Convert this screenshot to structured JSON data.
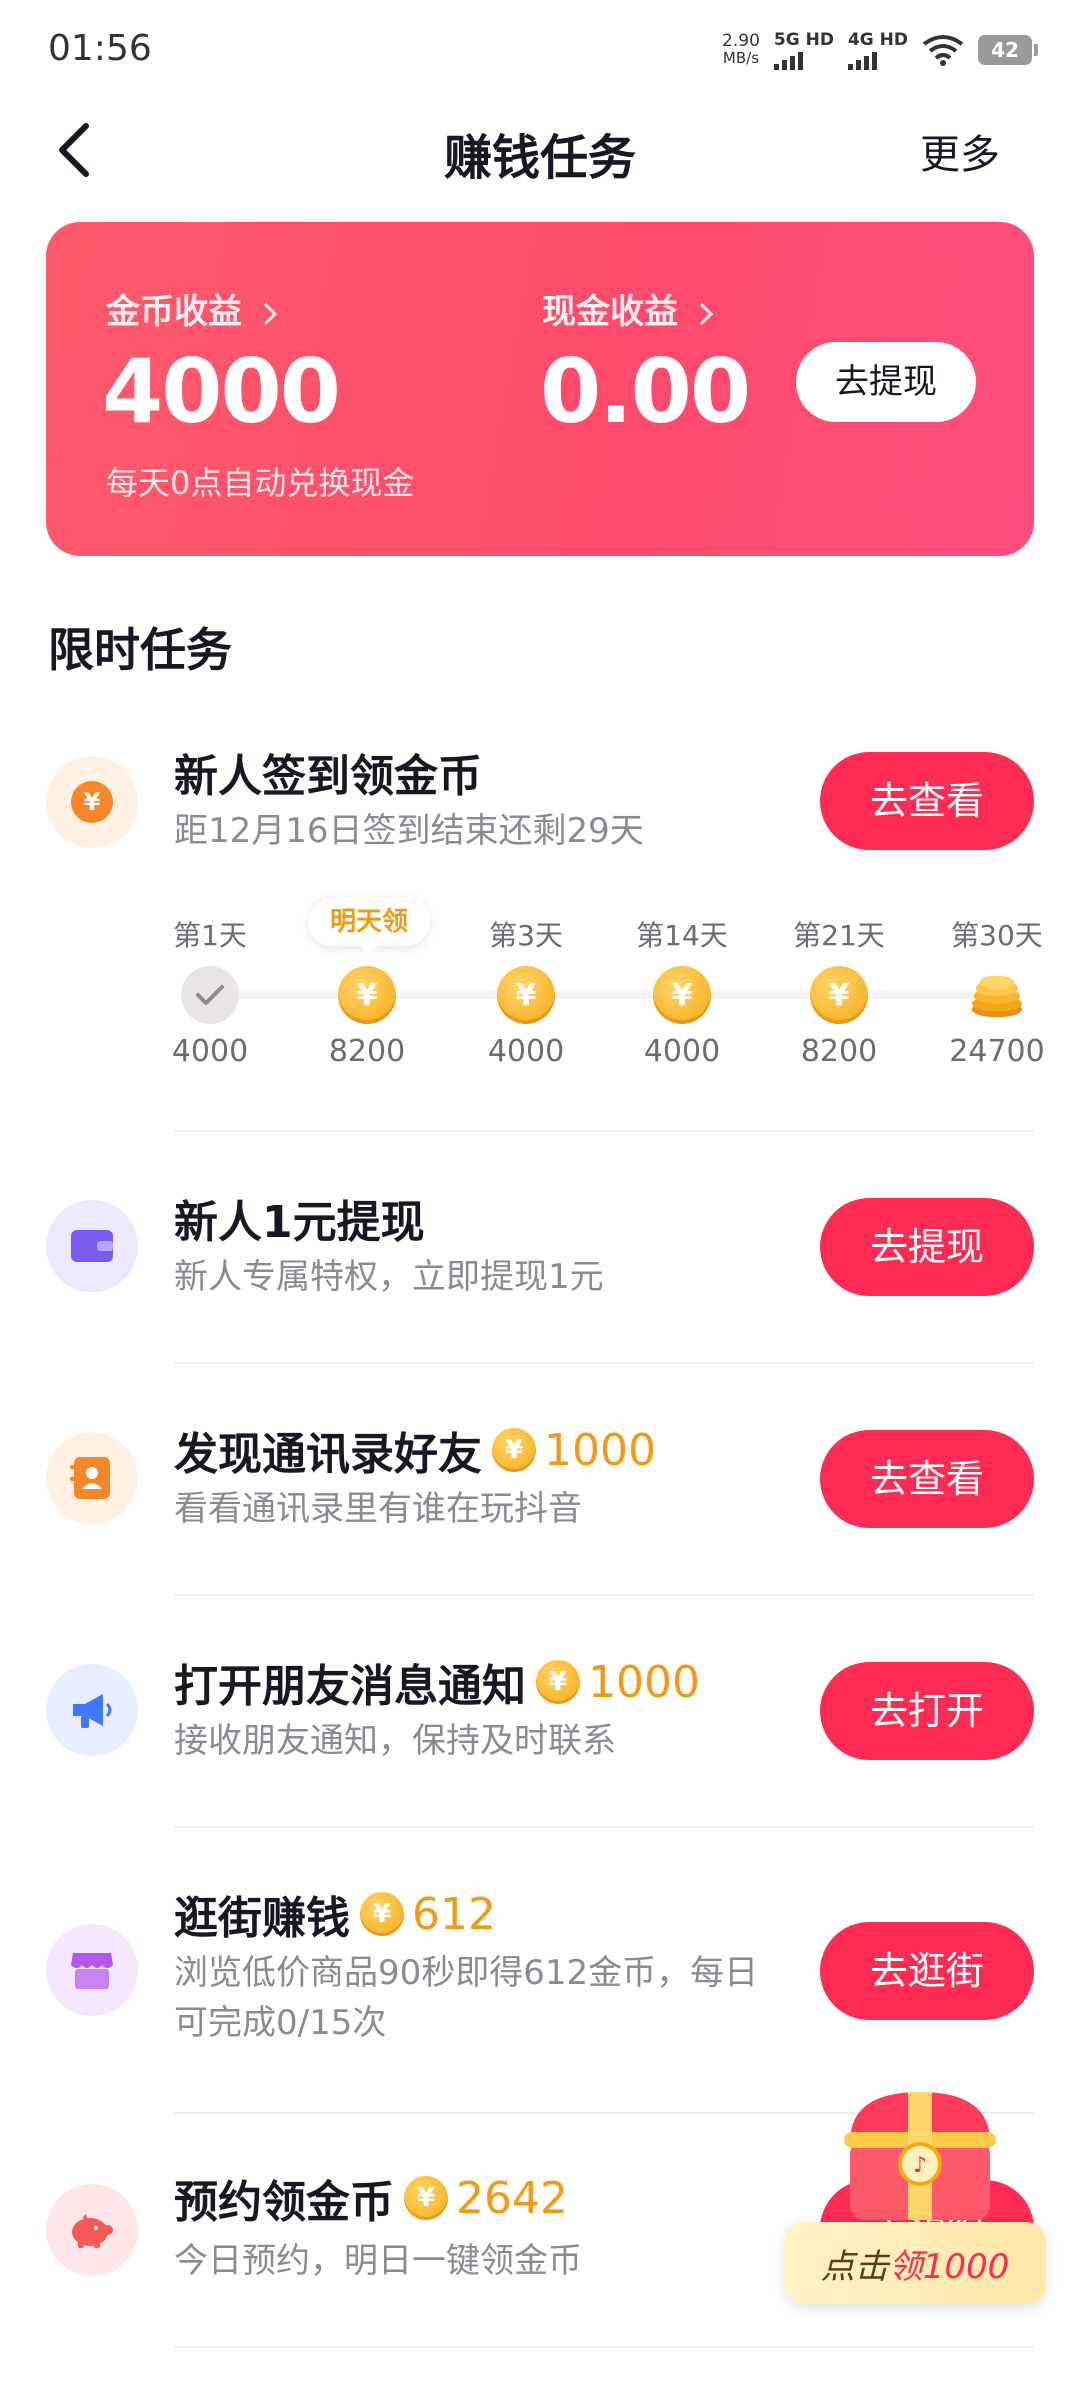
{
  "status": {
    "time": "01:56",
    "net_speed": "2.90",
    "net_unit": "MB/s",
    "sim1": "5G HD",
    "sim2": "4G HD",
    "battery": "42"
  },
  "nav": {
    "title": "赚钱任务",
    "more": "更多"
  },
  "earnings": {
    "coin_label": "金币收益",
    "coin_value": "4000",
    "cash_label": "现金收益",
    "cash_value": "0.00",
    "subtitle": "每天0点自动兑换现金",
    "withdraw": "去提现"
  },
  "section_title": "限时任务",
  "checkin": {
    "title": "新人签到领金币",
    "desc": "距12月16日签到结束还剩29天",
    "button": "去查看",
    "tooltip": "明天领",
    "days": [
      {
        "label": "第1天",
        "amount": "4000",
        "status": "done"
      },
      {
        "label": "",
        "amount": "8200",
        "status": "tomorrow"
      },
      {
        "label": "第3天",
        "amount": "4000",
        "status": "pending"
      },
      {
        "label": "第14天",
        "amount": "4000",
        "status": "pending"
      },
      {
        "label": "第21天",
        "amount": "8200",
        "status": "pending"
      },
      {
        "label": "第30天",
        "amount": "24700",
        "status": "big"
      }
    ]
  },
  "tasks": [
    {
      "title": "新人1元提现",
      "desc": "新人专属特权，立即提现1元",
      "reward": "",
      "button": "去提现",
      "icon": "wallet-icon",
      "icon_bg": "#ece8fd",
      "icon_color": "#7b5cf0"
    },
    {
      "title": "发现通讯录好友",
      "desc": "看看通讯录里有谁在玩抖音",
      "reward": "1000",
      "button": "去查看",
      "icon": "contacts-icon",
      "icon_bg": "#fff0e3",
      "icon_color": "#f5862a"
    },
    {
      "title": "打开朋友消息通知",
      "desc": "接收朋友通知，保持及时联系",
      "reward": "1000",
      "button": "去打开",
      "icon": "megaphone-icon",
      "icon_bg": "#e6eeff",
      "icon_color": "#3d78ff"
    },
    {
      "title": "逛街赚钱",
      "desc": "浏览低价商品90秒即得612金币，每日可完成0/15次",
      "reward": "612",
      "button": "去逛街",
      "icon": "shop-icon",
      "icon_bg": "#f3e6fd",
      "icon_color": "#b456f0"
    },
    {
      "title": "预约领金币",
      "desc": "今日预约，明日一键领金币",
      "reward": "2642",
      "button": "去预约",
      "icon": "piggy-bank-icon",
      "icon_bg": "#ffe6e6",
      "icon_color": "#f55a5a"
    }
  ],
  "float_badge": {
    "prefix": "点击",
    "highlight": "领1000"
  },
  "colors": {
    "brand": "#fe2c55",
    "gold": "#f29a16"
  }
}
